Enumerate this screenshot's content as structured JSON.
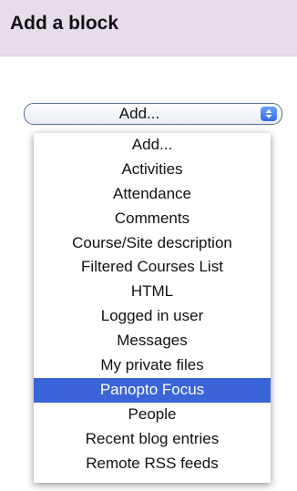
{
  "block": {
    "title": "Add a block"
  },
  "select": {
    "value": "Add..."
  },
  "dropdown": {
    "options": [
      {
        "label": "Add..."
      },
      {
        "label": "Activities"
      },
      {
        "label": "Attendance"
      },
      {
        "label": "Comments"
      },
      {
        "label": "Course/Site description"
      },
      {
        "label": "Filtered Courses List"
      },
      {
        "label": "HTML"
      },
      {
        "label": "Logged in user"
      },
      {
        "label": "Messages"
      },
      {
        "label": "My private files"
      },
      {
        "label": "Panopto Focus"
      },
      {
        "label": "People"
      },
      {
        "label": "Recent blog entries"
      },
      {
        "label": "Remote RSS feeds"
      }
    ],
    "highlighted": "Panopto Focus"
  },
  "colors": {
    "header_bg": "#e6dcea",
    "highlight_bg": "#3b64d8"
  }
}
